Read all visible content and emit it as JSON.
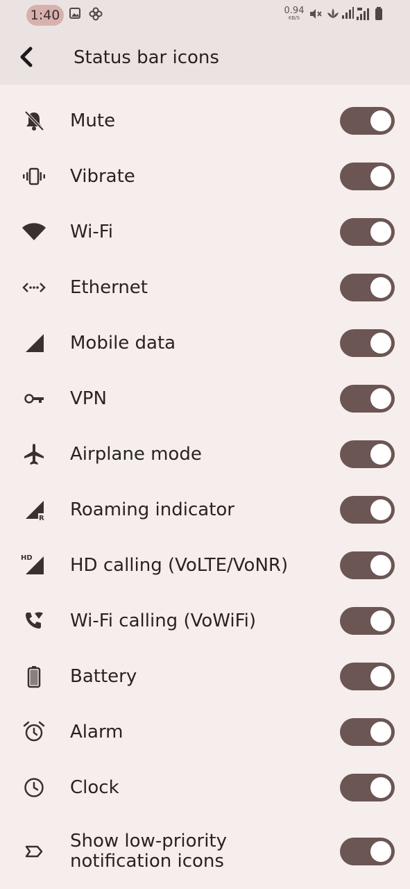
{
  "status_bar": {
    "time": "1:40",
    "net_speed_value": "0.94",
    "net_speed_unit": "KB/S"
  },
  "header": {
    "title": "Status bar icons"
  },
  "colors": {
    "background": "#f6eeed",
    "header_background": "#ebe3e2",
    "toggle_track_on": "#6b5654",
    "toggle_knob": "#ffffff",
    "time_pill": "#d8b1ae"
  },
  "settings": [
    {
      "label": "Mute",
      "icon": "bell-off-icon",
      "enabled": true
    },
    {
      "label": "Vibrate",
      "icon": "vibrate-icon",
      "enabled": true
    },
    {
      "label": "Wi-Fi",
      "icon": "wifi-icon",
      "enabled": true
    },
    {
      "label": "Ethernet",
      "icon": "ethernet-icon",
      "enabled": true
    },
    {
      "label": "Mobile data",
      "icon": "mobile-signal-icon",
      "enabled": true
    },
    {
      "label": "VPN",
      "icon": "vpn-key-icon",
      "enabled": true
    },
    {
      "label": "Airplane mode",
      "icon": "airplane-icon",
      "enabled": true
    },
    {
      "label": "Roaming indicator",
      "icon": "roaming-signal-icon",
      "enabled": true
    },
    {
      "label": "HD calling (VoLTE/VoNR)",
      "icon": "hd-signal-icon",
      "enabled": true
    },
    {
      "label": "Wi-Fi calling (VoWiFi)",
      "icon": "wifi-calling-icon",
      "enabled": true
    },
    {
      "label": "Battery",
      "icon": "battery-icon",
      "enabled": true
    },
    {
      "label": "Alarm",
      "icon": "alarm-icon",
      "enabled": true
    },
    {
      "label": "Clock",
      "icon": "clock-icon",
      "enabled": true
    },
    {
      "label_line1": "Show low-priority",
      "label_line2": "notification icons",
      "icon": "low-priority-icon",
      "enabled": true
    }
  ]
}
